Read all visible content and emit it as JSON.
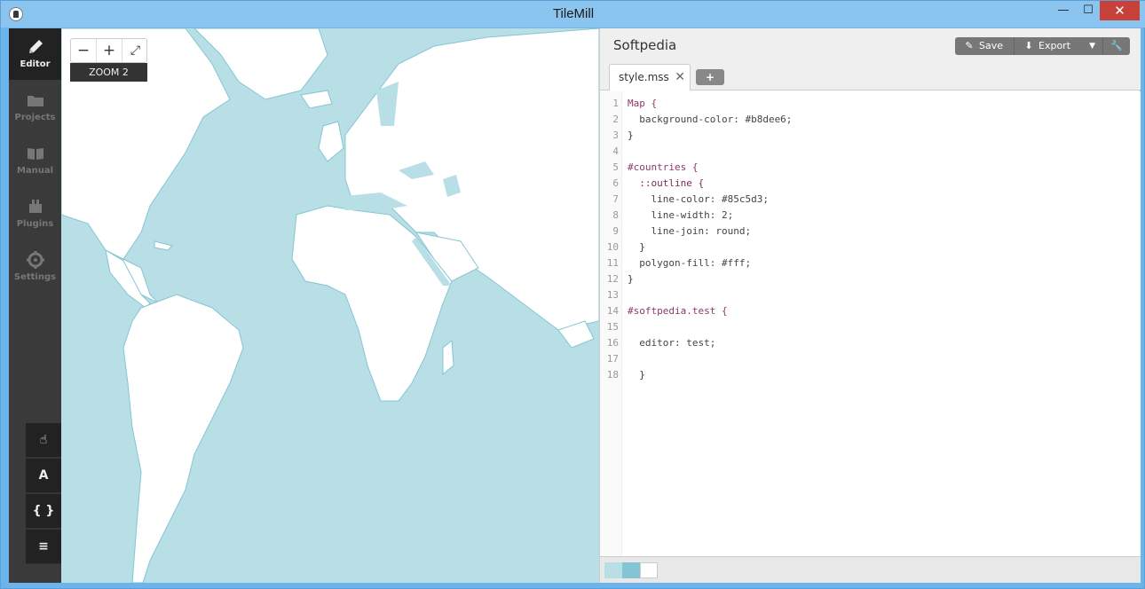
{
  "window": {
    "title": "TileMill",
    "min": "—",
    "max": "☐",
    "close": "✕"
  },
  "sidebar": {
    "items": [
      {
        "label": "Editor",
        "icon": "pencil-icon"
      },
      {
        "label": "Projects",
        "icon": "folder-icon"
      },
      {
        "label": "Manual",
        "icon": "book-icon"
      },
      {
        "label": "Plugins",
        "icon": "plugin-icon"
      },
      {
        "label": "Settings",
        "icon": "gear-icon"
      }
    ]
  },
  "map_tools": [
    {
      "name": "pan-tool",
      "glyph": "☝"
    },
    {
      "name": "label-tool",
      "glyph": "A"
    },
    {
      "name": "code-tool",
      "glyph": "{ }"
    },
    {
      "name": "layers-tool",
      "glyph": "≡"
    }
  ],
  "map": {
    "zoom_minus": "−",
    "zoom_plus": "+",
    "fullscreen": "⤢",
    "zoom_label": "ZOOM 2",
    "background_color": "#b8dee6",
    "land_color": "#ffffff",
    "outline_color": "#85c5d3"
  },
  "editor": {
    "project_title": "Softpedia",
    "save_label": "Save",
    "export_label": "Export",
    "tab_label": "style.mss",
    "tab_close": "✕",
    "tab_add": "+",
    "line_numbers": [
      "1",
      "2",
      "3",
      "4",
      "5",
      "6",
      "7",
      "8",
      "9",
      "10",
      "11",
      "12",
      "13",
      "14",
      "15",
      "16",
      "17",
      "18"
    ],
    "code": [
      "Map {",
      "  background-color: #b8dee6;",
      "}",
      "",
      "#countries {",
      "  ::outline {",
      "    line-color: #85c5d3;",
      "    line-width: 2;",
      "    line-join: round;",
      "  }",
      "  polygon-fill: #fff;",
      "}",
      "",
      "#softpedia.test {",
      "",
      "  editor: test;",
      "",
      "  }"
    ],
    "swatches": [
      "#b8dee6",
      "#85c5d3",
      "#ffffff"
    ]
  }
}
